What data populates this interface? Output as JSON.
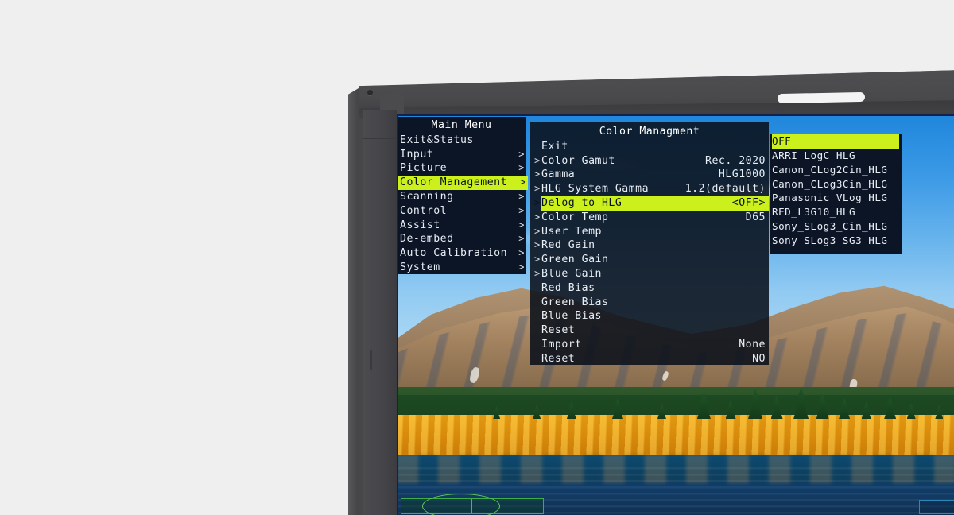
{
  "device": {
    "type": "field-monitor",
    "bezel_color": "#47474a",
    "led_label": "power-led",
    "logo_label": "brand-logo"
  },
  "osd": {
    "highlight_color": "#ccf01c",
    "panel_bg": "#0c1526",
    "text_color": "#e9eef5",
    "main_menu": {
      "title": "Main Menu",
      "items": [
        {
          "label": "Exit&Status",
          "chevron": "",
          "selected": false
        },
        {
          "label": "Input",
          "chevron": ">",
          "selected": false
        },
        {
          "label": "Picture",
          "chevron": ">",
          "selected": false
        },
        {
          "label": "Color Management",
          "chevron": ">",
          "selected": true
        },
        {
          "label": "Scanning",
          "chevron": ">",
          "selected": false
        },
        {
          "label": "Control",
          "chevron": ">",
          "selected": false
        },
        {
          "label": "Assist",
          "chevron": ">",
          "selected": false
        },
        {
          "label": "De-embed",
          "chevron": ">",
          "selected": false
        },
        {
          "label": "Auto Calibration",
          "chevron": ">",
          "selected": false
        },
        {
          "label": "System",
          "chevron": ">",
          "selected": false
        }
      ]
    },
    "sub_menu": {
      "title": "Color Managment",
      "items": [
        {
          "arrow": "",
          "label": "Exit",
          "value": "",
          "selected": false
        },
        {
          "arrow": ">",
          "label": "Color Gamut",
          "value": "Rec. 2020",
          "selected": false
        },
        {
          "arrow": ">",
          "label": "Gamma",
          "value": "HLG1000",
          "selected": false
        },
        {
          "arrow": ">",
          "label": "HLG System Gamma",
          "value": "1.2(default)",
          "selected": false
        },
        {
          "arrow": ">",
          "label": "Delog to HLG",
          "value": "<OFF>",
          "selected": true
        },
        {
          "arrow": ">",
          "label": "Color Temp",
          "value": "D65",
          "selected": false
        },
        {
          "arrow": ">",
          "label": "User Temp",
          "value": "",
          "selected": false
        },
        {
          "arrow": ">",
          "label": "Red Gain",
          "value": "",
          "selected": false
        },
        {
          "arrow": ">",
          "label": "Green Gain",
          "value": "",
          "selected": false
        },
        {
          "arrow": ">",
          "label": "Blue Gain",
          "value": "",
          "selected": false
        },
        {
          "arrow": "",
          "label": "Red Bias",
          "value": "",
          "selected": false
        },
        {
          "arrow": "",
          "label": "Green Bias",
          "value": "",
          "selected": false
        },
        {
          "arrow": "",
          "label": "Blue Bias",
          "value": "",
          "selected": false
        },
        {
          "arrow": "",
          "label": "Reset",
          "value": "",
          "selected": false
        },
        {
          "arrow": "",
          "label": "Import",
          "value": "None",
          "selected": false
        },
        {
          "arrow": "",
          "label": "Reset",
          "value": "NO",
          "selected": false
        }
      ]
    },
    "options_menu": {
      "items": [
        {
          "label": "OFF",
          "selected": true
        },
        {
          "label": "ARRI_LogC_HLG",
          "selected": false
        },
        {
          "label": "Canon_CLog2Cin_HLG",
          "selected": false
        },
        {
          "label": "Canon_CLog3Cin_HLG",
          "selected": false
        },
        {
          "label": "Panasonic_VLog_HLG",
          "selected": false
        },
        {
          "label": "RED_L3G10_HLG",
          "selected": false
        },
        {
          "label": "Sony_SLog3_Cin_HLG",
          "selected": false
        },
        {
          "label": "Sony_SLog3_SG3_HLG",
          "selected": false
        }
      ]
    }
  }
}
